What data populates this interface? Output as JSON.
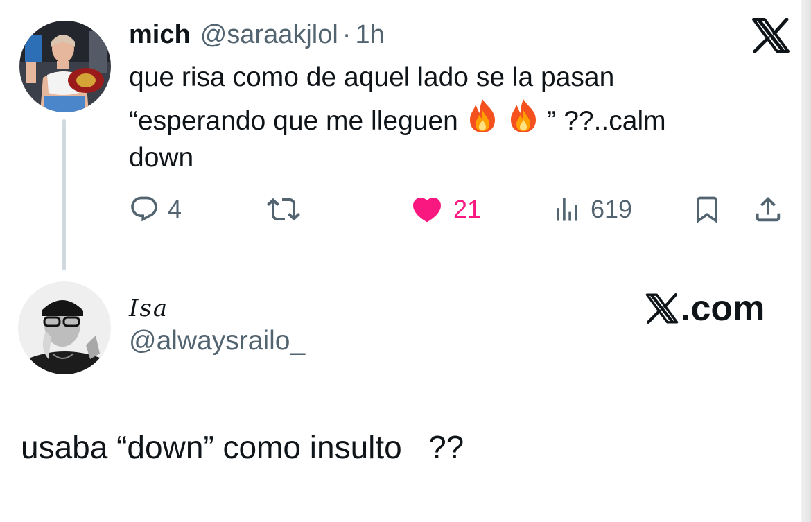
{
  "tweet": {
    "display_name": "mich",
    "handle": "@saraakjlol",
    "separator": "·",
    "time": "1h",
    "text_lines": [
      "que risa como de aquel lado se la pasan",
      "“esperando que me lleguen",
      "” ??..calm",
      "down"
    ],
    "emoji": "fire-emoji",
    "counts": {
      "replies": "4",
      "likes": "21",
      "views": "619"
    },
    "liked": true,
    "colors": {
      "text": "#0f1419",
      "muted": "#536471",
      "like": "#f91880",
      "thread_line": "#cfd9de"
    }
  },
  "reply_card": {
    "display_name": "Isa",
    "handle": "@alwaysrailo_",
    "brand": ".com",
    "comment": "usaba “down” como insulto   ??"
  },
  "icons": [
    "x-logo-icon",
    "reply-icon",
    "retweet-icon",
    "heart-icon",
    "views-icon",
    "bookmark-icon",
    "share-icon"
  ]
}
